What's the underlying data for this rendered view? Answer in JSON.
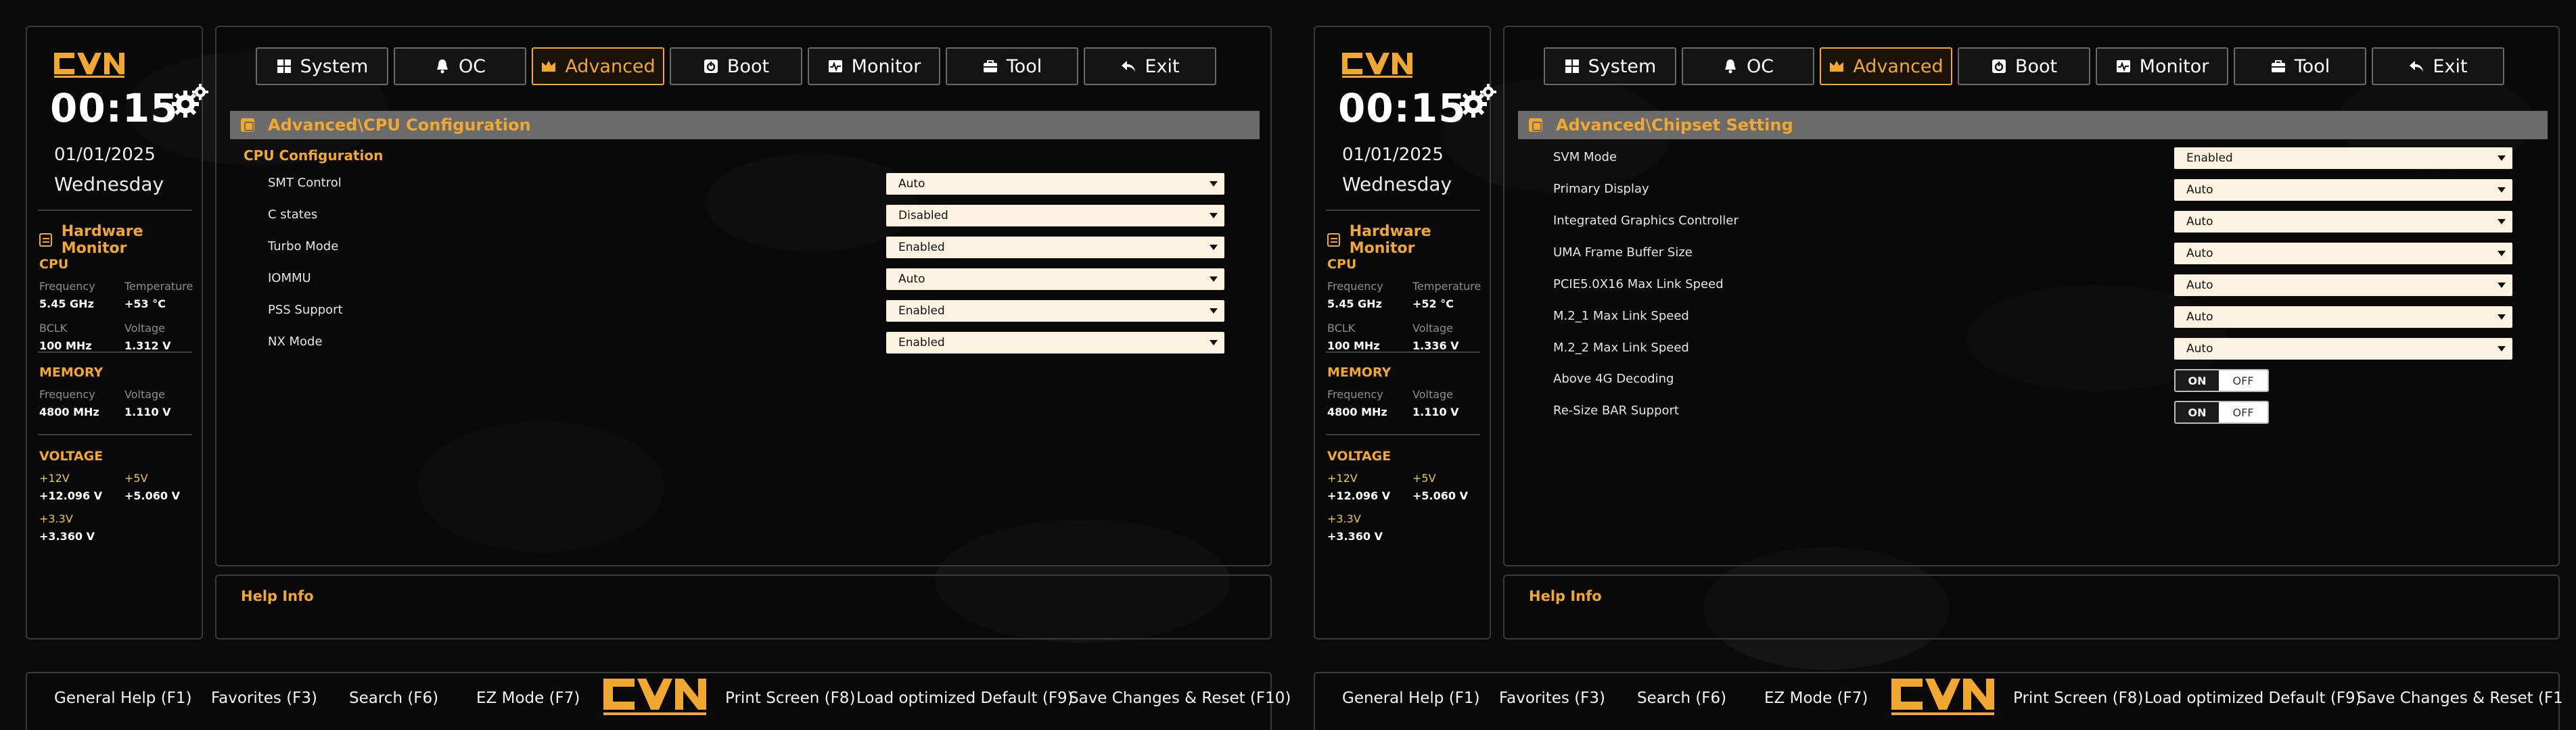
{
  "brand": {
    "accent": "#f0a830"
  },
  "clock": {
    "time": "00:15",
    "date": "01/01/2025",
    "weekday": "Wednesday"
  },
  "monitor": {
    "title": "Hardware Monitor",
    "cpu_title": "CPU",
    "memory_title": "MEMORY",
    "voltage_title": "VOLTAGE",
    "labels": {
      "frequency": "Frequency",
      "temperature": "Temperature",
      "bclk": "BCLK",
      "voltage": "Voltage",
      "v12": "+12V",
      "v5": "+5V",
      "v33": "+3.3V"
    }
  },
  "monitor_left": {
    "cpu_freq": "5.45 GHz",
    "cpu_temp": "+53 °C",
    "bclk": "100 MHz",
    "cpu_volt": "1.312 V",
    "mem_freq": "4800 MHz",
    "mem_volt": "1.110 V",
    "v12": "+12.096 V",
    "v5": "+5.060 V",
    "v33": "+3.360 V"
  },
  "monitor_right": {
    "cpu_freq": "5.45 GHz",
    "cpu_temp": "+52 °C",
    "bclk": "100 MHz",
    "cpu_volt": "1.336 V",
    "mem_freq": "4800 MHz",
    "mem_volt": "1.110 V",
    "v12": "+12.096 V",
    "v5": "+5.060 V",
    "v33": "+3.360 V"
  },
  "tabs": [
    {
      "label": "System",
      "icon": "grid-icon"
    },
    {
      "label": "OC",
      "icon": "bell-icon"
    },
    {
      "label": "Advanced",
      "icon": "crown-icon",
      "active": true
    },
    {
      "label": "Boot",
      "icon": "power-icon"
    },
    {
      "label": "Monitor",
      "icon": "pulse-icon"
    },
    {
      "label": "Tool",
      "icon": "toolbox-icon"
    },
    {
      "label": "Exit",
      "icon": "back-arrow-icon"
    }
  ],
  "left_page": {
    "breadcrumb": "Advanced\\CPU Configuration",
    "section": "CPU Configuration",
    "settings": [
      {
        "label": "SMT Control",
        "value": "Auto"
      },
      {
        "label": "C states",
        "value": "Disabled"
      },
      {
        "label": "Turbo Mode",
        "value": "Enabled"
      },
      {
        "label": "IOMMU",
        "value": "Auto"
      },
      {
        "label": "PSS Support",
        "value": "Enabled"
      },
      {
        "label": "NX Mode",
        "value": "Enabled"
      }
    ]
  },
  "right_page": {
    "breadcrumb": "Advanced\\Chipset Setting",
    "settings": [
      {
        "label": "SVM Mode",
        "value": "Enabled"
      },
      {
        "label": "Primary Display",
        "value": "Auto"
      },
      {
        "label": "Integrated Graphics Controller",
        "value": "Auto"
      },
      {
        "label": "UMA Frame Buffer Size",
        "value": "Auto"
      },
      {
        "label": "PCIE5.0X16 Max Link Speed",
        "value": "Auto"
      },
      {
        "label": "M.2_1 Max Link Speed",
        "value": "Auto"
      },
      {
        "label": "M.2_2 Max Link Speed",
        "value": "Auto"
      }
    ],
    "toggles": [
      {
        "label": "Above 4G Decoding",
        "on": "ON",
        "off": "OFF"
      },
      {
        "label": "Re-Size BAR Support",
        "on": "ON",
        "off": "OFF"
      }
    ]
  },
  "help": {
    "title": "Help Info"
  },
  "footer": {
    "general_help": "General Help (F1)",
    "favorites": "Favorites (F3)",
    "search": "Search (F6)",
    "ez_mode": "EZ Mode (F7)",
    "print_screen": "Print Screen (F8)",
    "load_default": "Load optimized Default (F9)",
    "save_reset": "Save Changes & Reset (F10)",
    "save_reset_right": "Save Changes & Reset (F1"
  }
}
